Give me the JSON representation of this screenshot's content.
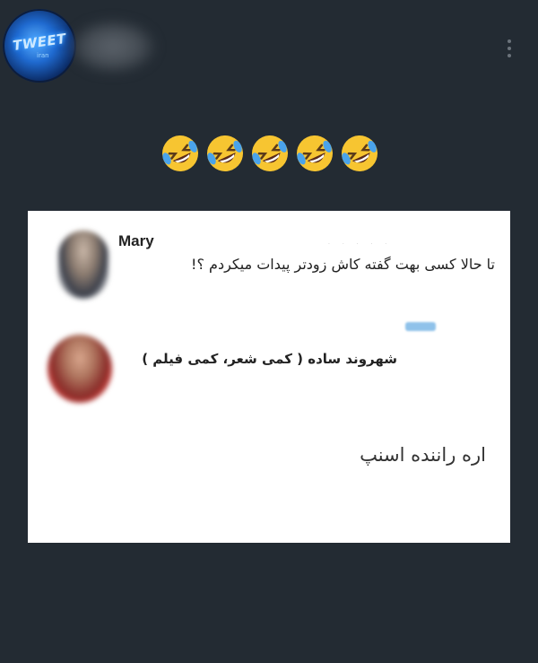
{
  "header": {
    "avatar_logo_text": "TWEET",
    "avatar_logo_sub": "iran",
    "emoji_count": 5
  },
  "card": {
    "first_reply": {
      "author": "Mary",
      "text": "تا حالا کسی بهت گفته کاش زودتر پیدات میکردم ؟!"
    },
    "second_reply": {
      "author": "شهروند ساده ( کمی شعر، کمی فیلم )",
      "text": "اره راننده اسنپ"
    }
  },
  "colors": {
    "background": "#232b33",
    "card": "#ffffff",
    "emoji_face": "#f7c531",
    "tears": "#4aa3ea"
  }
}
